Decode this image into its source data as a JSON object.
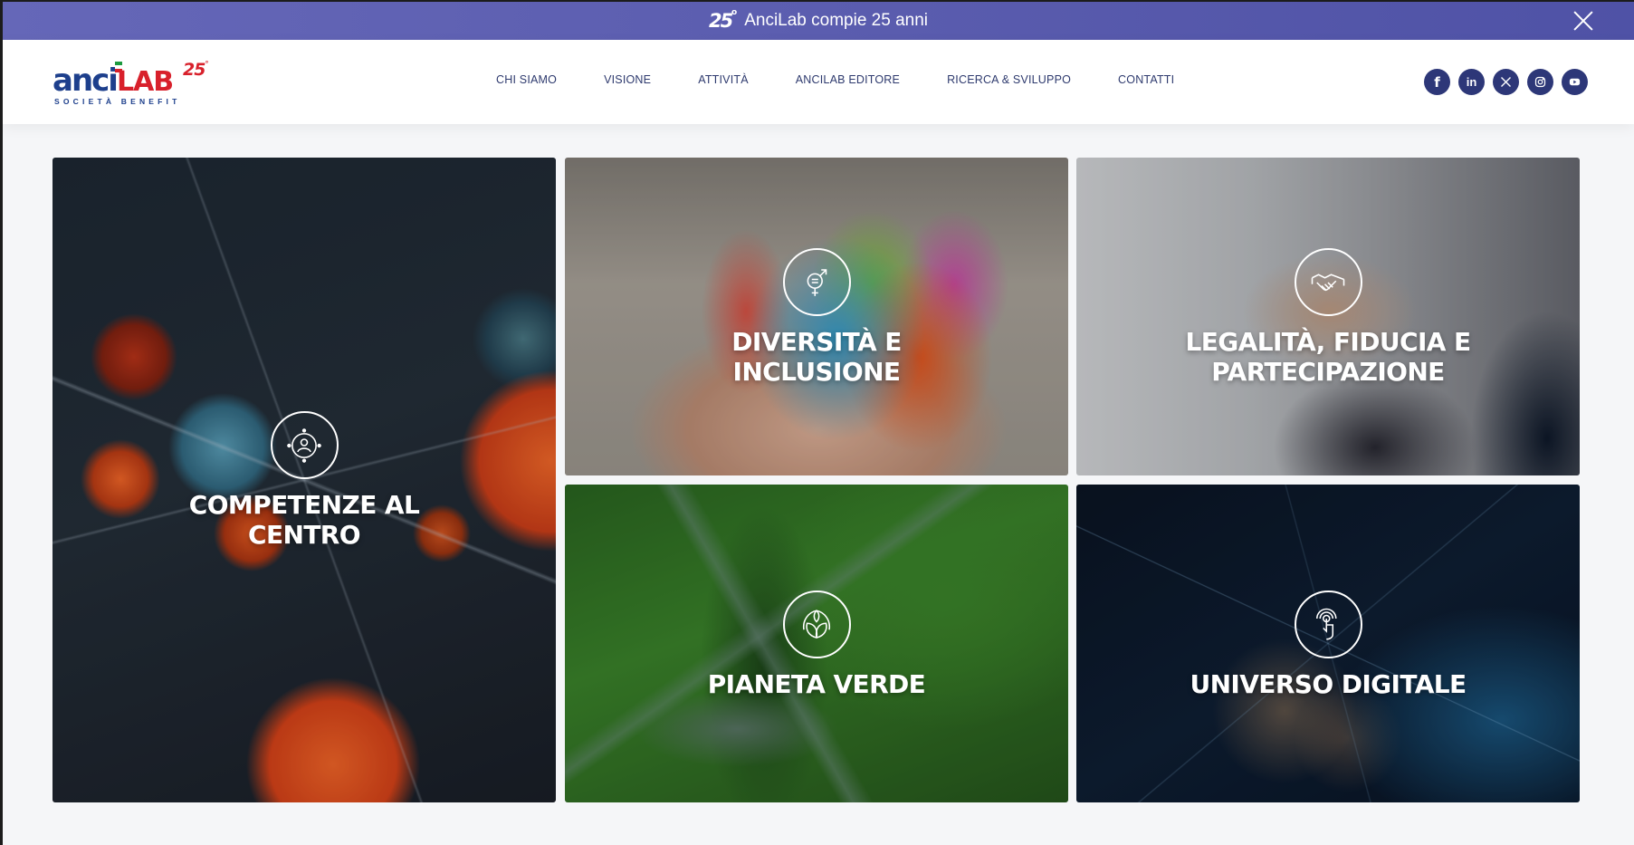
{
  "announcement": {
    "badge": "25",
    "text": "AnciLab compie 25 anni"
  },
  "logo": {
    "word_a": "anci",
    "word_b": "LAB",
    "anniversary": "25",
    "tagline": "SOCIETÀ BENEFIT"
  },
  "nav": {
    "items": [
      {
        "label": "CHI SIAMO"
      },
      {
        "label": "VISIONE"
      },
      {
        "label": "ATTIVITÀ"
      },
      {
        "label": "ANCILAB EDITORE"
      },
      {
        "label": "RICERCA & SVILUPPO"
      },
      {
        "label": "CONTATTI"
      }
    ]
  },
  "social": {
    "items": [
      {
        "name": "facebook-icon",
        "glyph": "f"
      },
      {
        "name": "linkedin-icon",
        "glyph": "in"
      },
      {
        "name": "x-icon",
        "glyph": "X"
      },
      {
        "name": "instagram-icon",
        "glyph": ""
      },
      {
        "name": "youtube-icon",
        "glyph": ""
      }
    ]
  },
  "cards": {
    "competenze": {
      "title": "COMPETENZE AL\nCENTRO",
      "icon": "people-target-icon"
    },
    "diversita": {
      "title": "DIVERSITÀ E\nINCLUSIONE",
      "icon": "gender-icon"
    },
    "legalita": {
      "title": "LEGALITÀ, FIDUCIA E\nPARTECIPAZIONE",
      "icon": "handshake-icon"
    },
    "verde": {
      "title": "PIANETA VERDE",
      "icon": "leaves-icon"
    },
    "digitale": {
      "title": "UNIVERSO DIGITALE",
      "icon": "touch-icon"
    }
  },
  "colors": {
    "announcement_bg": "#5b5daf",
    "nav_text": "#2e3a6e",
    "social_bg": "#2d3778",
    "brand_blue": "#1d3f8c",
    "brand_red": "#d8202b"
  }
}
